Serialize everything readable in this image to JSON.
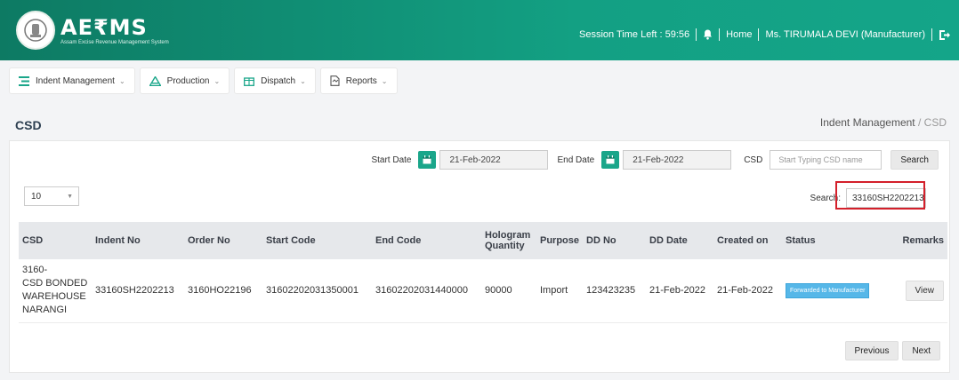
{
  "header": {
    "brand_name": "AE₹MS",
    "brand_sub": "Assam Excise Revenue Management System",
    "session_label": "Session Time Left : 59:56",
    "home_label": "Home",
    "user_label": "Ms. TIRUMALA DEVI (Manufacturer)"
  },
  "nav": [
    {
      "label": "Indent Management",
      "icon": "list-icon"
    },
    {
      "label": "Production",
      "icon": "warning-triangle-icon"
    },
    {
      "label": "Dispatch",
      "icon": "box-icon"
    },
    {
      "label": "Reports",
      "icon": "report-icon"
    }
  ],
  "page": {
    "title": "CSD",
    "breadcrumb_parent": "Indent Management",
    "breadcrumb_sep": " / ",
    "breadcrumb_current": "CSD"
  },
  "filters": {
    "start_label": "Start Date",
    "start_value": "21-Feb-2022",
    "end_label": "End Date",
    "end_value": "21-Feb-2022",
    "csd_label": "CSD",
    "csd_placeholder": "Start Typing CSD name",
    "search_button": "Search"
  },
  "table_controls": {
    "page_size": "10",
    "search_label": "Search:",
    "search_value": "33160SH2202213"
  },
  "table": {
    "headers": [
      "CSD",
      "Indent No",
      "Order No",
      "Start Code",
      "End Code",
      "Hologram Quantity",
      "Purpose",
      "DD No",
      "DD Date",
      "Created on",
      "Status",
      "Remarks"
    ],
    "rows": [
      {
        "csd": "3160-\nCSD BONDED\nWAREHOUSE\nNARANGI",
        "indent_no": "33160SH2202213",
        "order_no": "3160HO22196",
        "start_code": "31602202031350001",
        "end_code": "31602202031440000",
        "hologram_qty": "90000",
        "purpose": "Import",
        "dd_no": "123423235",
        "dd_date": "21-Feb-2022",
        "created_on": "21-Feb-2022",
        "status": "Forwarded to Manufacturer",
        "remarks": "View"
      }
    ]
  },
  "pager": {
    "previous": "Previous",
    "next": "Next"
  },
  "colors": {
    "header_green": "#13a083",
    "status_badge": "#56b7e8",
    "highlight": "#d4202b"
  }
}
